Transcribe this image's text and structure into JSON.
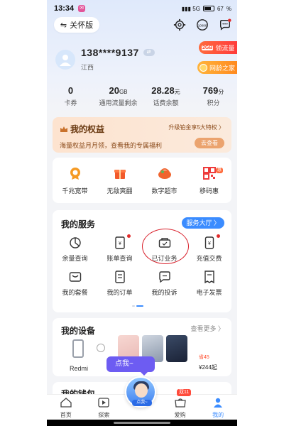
{
  "status": {
    "time": "13:34",
    "app_badge": "✉",
    "battery": "67"
  },
  "header": {
    "care_mode": "关怀版"
  },
  "profile": {
    "phone": "138****9137",
    "region": "江西",
    "switch": "⇄"
  },
  "promos": [
    {
      "badge": "2GB",
      "label": "领流量"
    },
    {
      "label": "网龄之家"
    }
  ],
  "stats": [
    {
      "value": "0",
      "unit": "",
      "label": "卡券"
    },
    {
      "value": "20",
      "unit": "GB",
      "label": "通用流量剩余"
    },
    {
      "value": "28.28",
      "unit": "元",
      "label": "话费余额"
    },
    {
      "value": "769",
      "unit": "分",
      "label": "积分"
    }
  ],
  "rights": {
    "title": "我的权益",
    "upgrade": "升级铂金享5大特权 〉",
    "desc": "海量权益月月领，查看我的专属福利",
    "go": "去查看"
  },
  "quick": [
    {
      "label": "千兆宽带",
      "color": "#f59a23"
    },
    {
      "label": "无敌爽翻",
      "color": "#f25a2b"
    },
    {
      "label": "数字超市",
      "color": "#f0642e"
    },
    {
      "label": "移码惠",
      "color": "#ee3b3b",
      "tag": "惠"
    }
  ],
  "services": {
    "title": "我的服务",
    "hall": "服务大厅 〉",
    "items": [
      {
        "label": "余量查询",
        "dot": false
      },
      {
        "label": "账单查询",
        "dot": true
      },
      {
        "label": "已订业务",
        "dot": false
      },
      {
        "label": "充值交费",
        "dot": true
      },
      {
        "label": "我的套餐",
        "dot": false
      },
      {
        "label": "我的订单",
        "dot": false
      },
      {
        "label": "我的投诉",
        "dot": false
      },
      {
        "label": "电子发票",
        "dot": false
      }
    ]
  },
  "devices": {
    "title": "我的设备",
    "more": "查看更多 〉",
    "device": "Redmi",
    "price_tag": "省45",
    "price": "¥244起"
  },
  "bubble": "点我~",
  "next_section": "我的钱包",
  "ai_label": "点我~",
  "tabs": [
    {
      "label": "首页",
      "active": false
    },
    {
      "label": "探索",
      "active": false
    },
    {
      "label": "",
      "active": false
    },
    {
      "label": "爱购",
      "active": false,
      "badge": "双11"
    },
    {
      "label": "我的",
      "active": true
    }
  ]
}
